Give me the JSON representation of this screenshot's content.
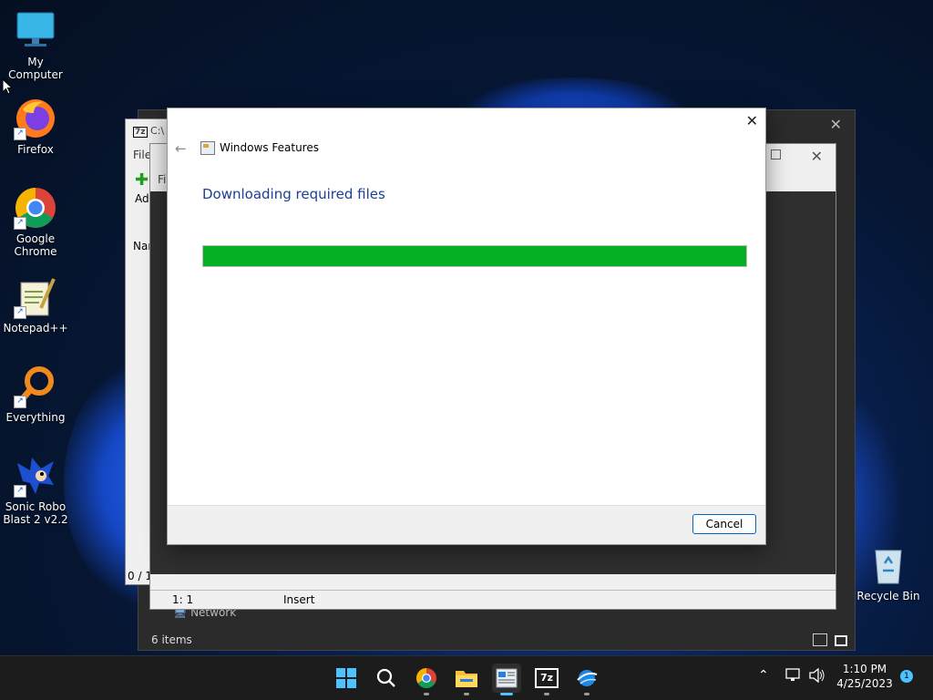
{
  "desktop": {
    "icons": [
      {
        "label": "My Computer",
        "icon": "monitor-icon"
      },
      {
        "label": "Firefox",
        "icon": "firefox-icon"
      },
      {
        "label": "Google Chrome",
        "icon": "chrome-icon"
      },
      {
        "label": "Notepad++",
        "icon": "notepadpp-icon"
      },
      {
        "label": "Everything",
        "icon": "everything-icon"
      },
      {
        "label": "Sonic Robo Blast 2 v2.2",
        "icon": "sonic-icon"
      },
      {
        "label": "Recycle Bin",
        "icon": "recycle-bin-icon"
      }
    ]
  },
  "background_windows": {
    "sevenzip": {
      "title_fragment": "C:\\",
      "menu_fragment": "File",
      "toolbar_fragment": "Ad",
      "col_fragment": "Nar",
      "status_fragment": "0 / 1"
    },
    "notepad": {
      "file_menu_fragment": "Fil",
      "status_pos": "1:  1",
      "status_mode": "Insert"
    },
    "explorer": {
      "nav_item": "Network",
      "status": "6 items"
    }
  },
  "dialog": {
    "title": "Windows Features",
    "heading": "Downloading required files",
    "progress": 1.0,
    "cancel_label": "Cancel"
  },
  "taskbar": {
    "apps": [
      {
        "name": "start",
        "icon": "windows-start-icon"
      },
      {
        "name": "search",
        "icon": "search-icon"
      },
      {
        "name": "chrome",
        "icon": "chrome-icon"
      },
      {
        "name": "file-explorer",
        "icon": "folder-icon"
      },
      {
        "name": "windows-features",
        "icon": "features-icon",
        "active": true
      },
      {
        "name": "7zip",
        "icon": "7zip-icon",
        "label": "7z"
      },
      {
        "name": "network-app",
        "icon": "globe-icon"
      }
    ],
    "clock": {
      "time": "1:10 PM",
      "date": "4/25/2023"
    },
    "notification_count": "1"
  },
  "colors": {
    "progress": "#06b025",
    "heading": "#1c3f94",
    "accent": "#0067c0"
  }
}
